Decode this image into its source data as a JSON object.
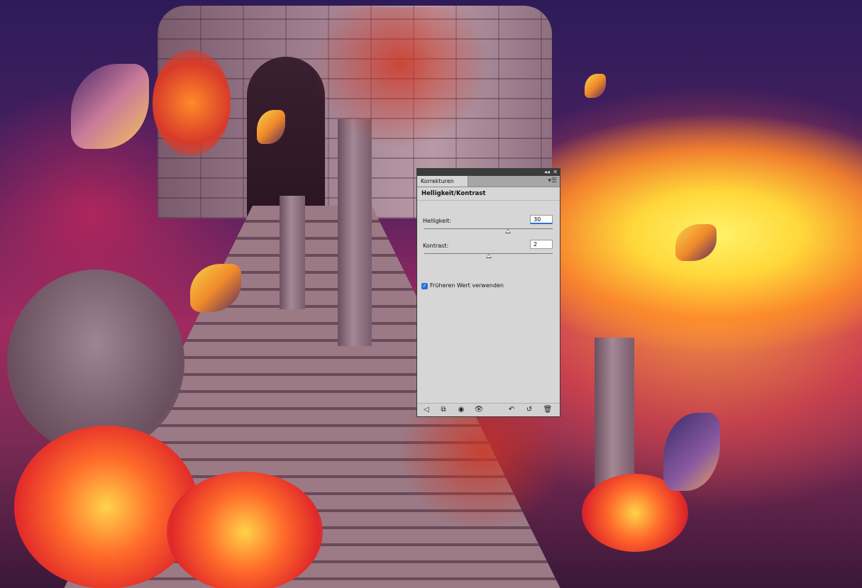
{
  "panel": {
    "tab_label": "Korrekturen",
    "title_collapse": "◂◂",
    "title_close": "✕",
    "menu_glyph": "▾☰",
    "header": "Helligkeit/Kontrast",
    "brightness": {
      "label": "Helligkeit:",
      "value": "30",
      "slider_fraction": 0.65
    },
    "contrast": {
      "label": "Kontrast:",
      "value": "2",
      "slider_fraction": 0.5
    },
    "checkbox": {
      "label": "Früheren Wert verwenden",
      "checked": true,
      "glyph": "✓"
    },
    "footer_icons": [
      {
        "name": "back-arrow-icon",
        "glyph": "◁"
      },
      {
        "name": "expand-view-icon",
        "glyph": "⧉"
      },
      {
        "name": "clip-to-layer-icon",
        "glyph": "◉"
      },
      {
        "name": "visibility-eye-icon",
        "glyph": "👁"
      },
      {
        "name": "view-previous-state-icon",
        "glyph": "↶"
      },
      {
        "name": "reset-icon",
        "glyph": "↺"
      },
      {
        "name": "trash-icon",
        "glyph": "🗑"
      }
    ]
  },
  "colors": {
    "panel_bg": "#d6d6d6",
    "titlebar": "#3b3b3b",
    "accent": "#2a72d6"
  }
}
